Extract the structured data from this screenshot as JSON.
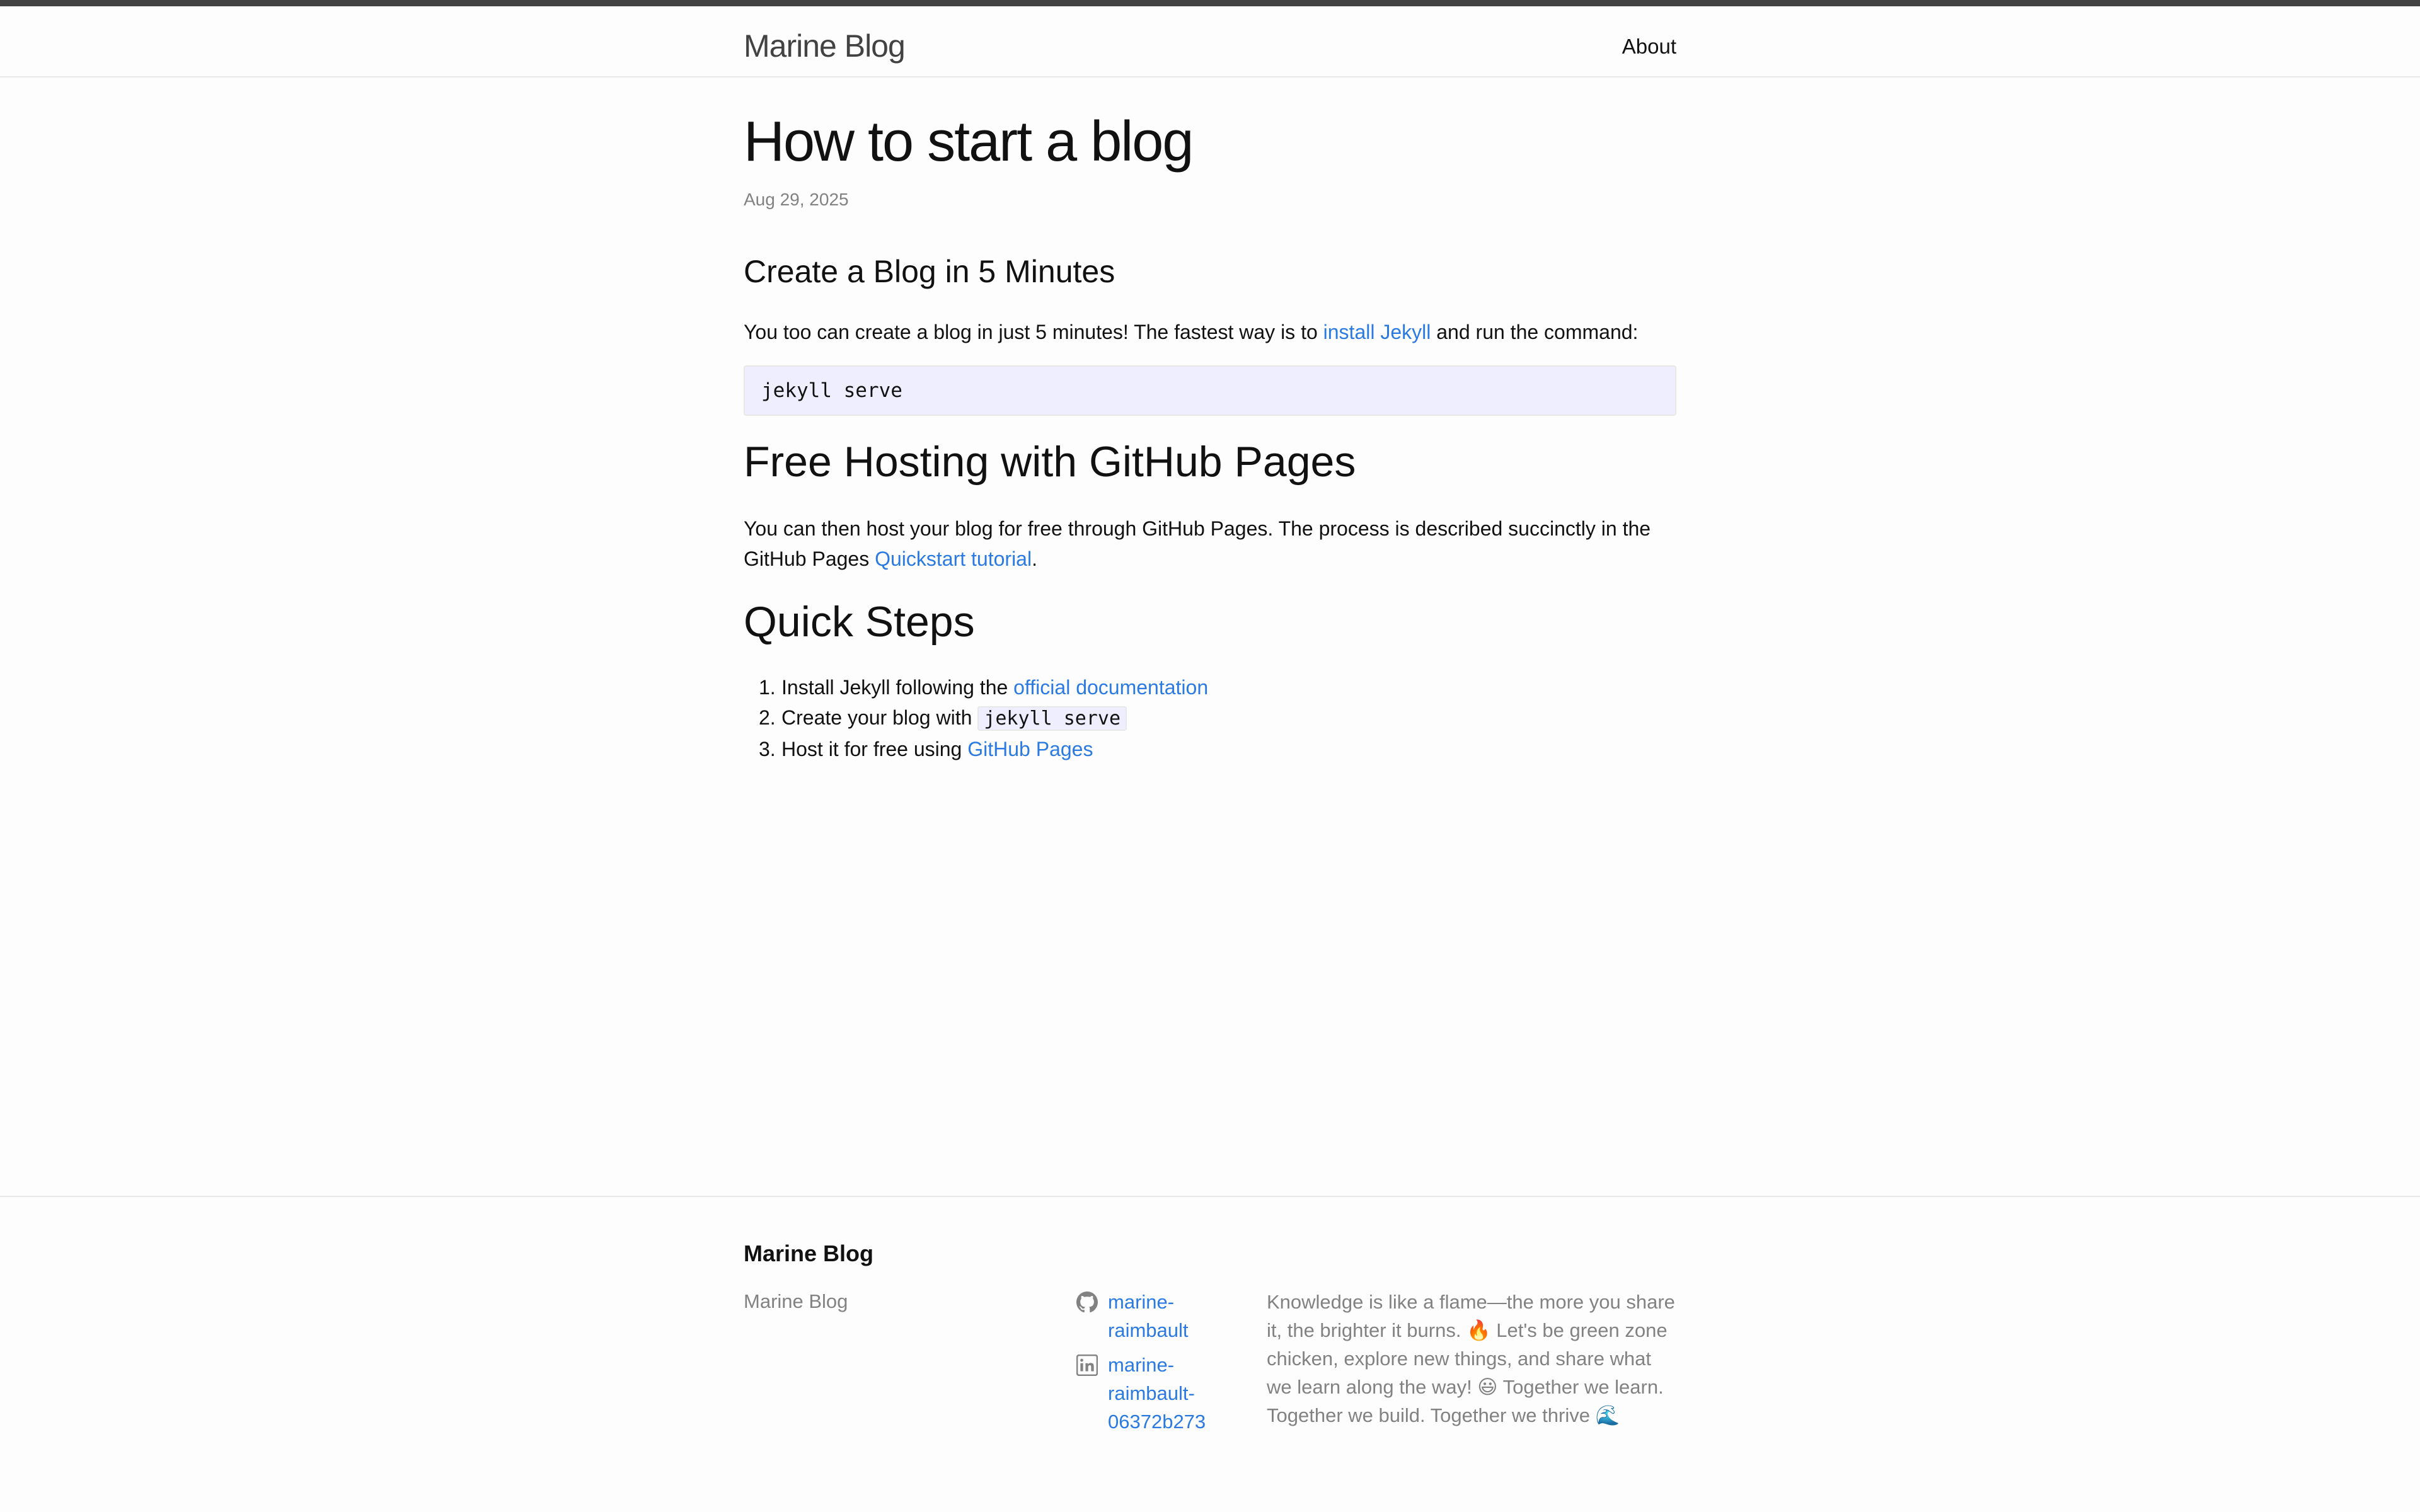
{
  "header": {
    "site_title": "Marine Blog",
    "nav": [
      {
        "label": "About"
      }
    ]
  },
  "post": {
    "title": "How to start a blog",
    "date": "Aug 29, 2025",
    "section1": {
      "heading": "Create a Blog in 5 Minutes",
      "text_before": "You too can create a blog in just 5 minutes! The fastest way is to ",
      "link": "install Jekyll",
      "text_after": " and run the command:",
      "code": "jekyll serve"
    },
    "section2": {
      "heading": "Free Hosting with GitHub Pages",
      "text_before": "You can then host your blog for free through GitHub Pages. The process is described succinctly in the GitHub Pages ",
      "link": "Quickstart tutorial",
      "text_after": "."
    },
    "section3": {
      "heading": "Quick Steps",
      "steps": [
        {
          "num": "1.",
          "text": "Install Jekyll following the ",
          "link": "official documentation",
          "code": ""
        },
        {
          "num": "2.",
          "text": "Create your blog with ",
          "link": "",
          "code": "jekyll serve"
        },
        {
          "num": "3.",
          "text": "Host it for free using ",
          "link": "GitHub Pages",
          "code": ""
        }
      ]
    }
  },
  "footer": {
    "heading": "Marine Blog",
    "site_name": "Marine Blog",
    "social": [
      {
        "icon": "github-icon",
        "label_line1": "marine-",
        "label_line2": "raimbault",
        "label_line3": ""
      },
      {
        "icon": "linkedin-icon",
        "label_line1": "marine-",
        "label_line2": "raimbault-",
        "label_line3": "06372b273"
      }
    ],
    "description": "Knowledge is like a flame—the more you share it, the brighter it burns. 🔥 Let's be green zone chicken, explore new things, and share what we learn along the way! 😃 Together we learn. Together we build. Together we thrive 🌊"
  },
  "colors": {
    "link": "#2a7ae2",
    "top_bar": "#424242",
    "code_bg": "#eeeeff",
    "muted_text": "#828282"
  }
}
